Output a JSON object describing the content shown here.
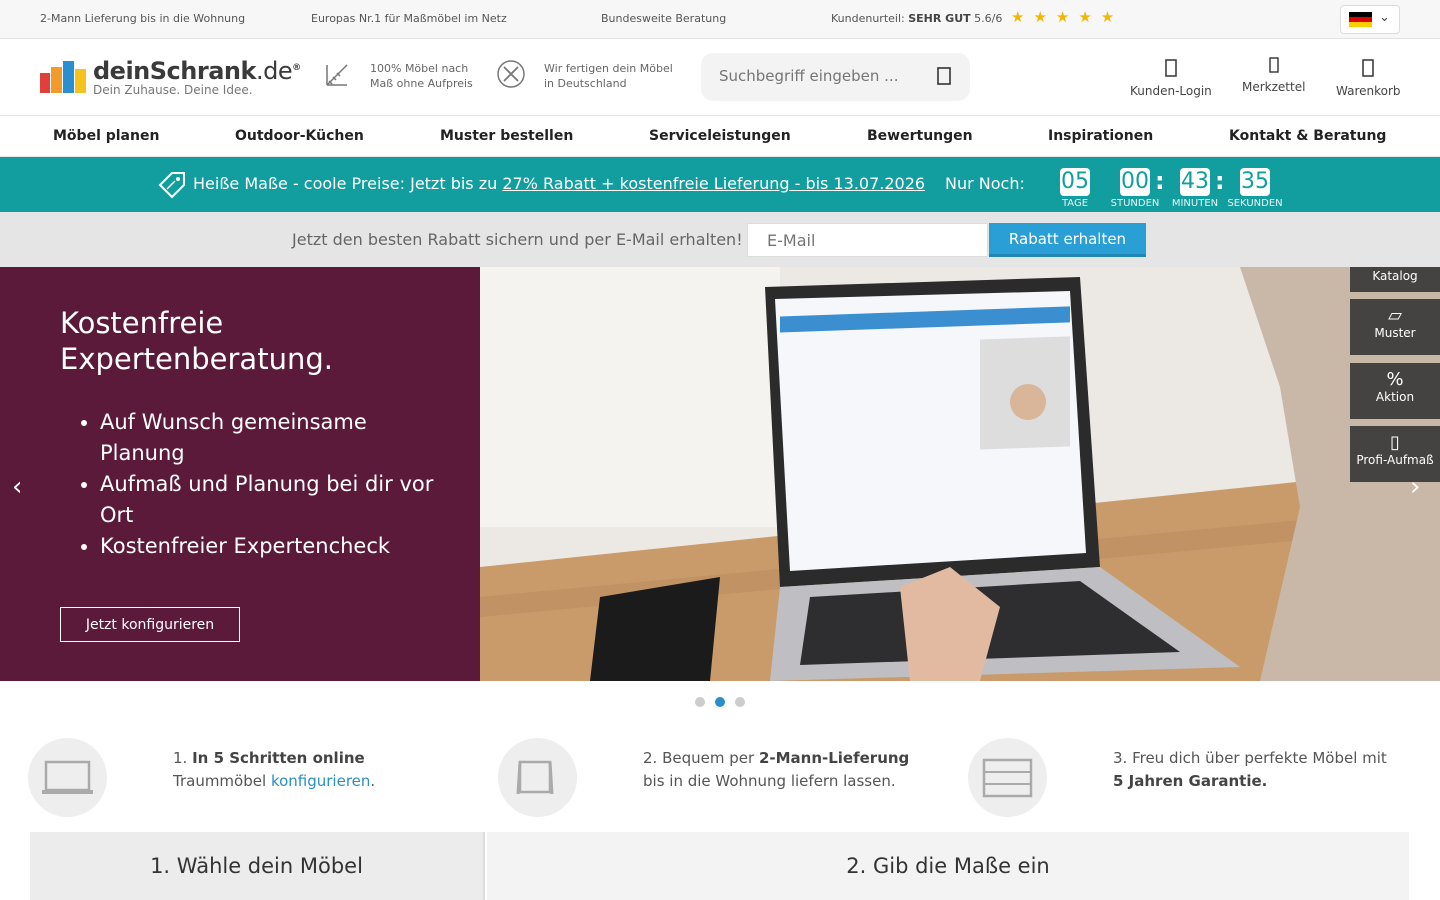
{
  "topbar": {
    "items": [
      "2-Mann Lieferung bis in die Wohnung",
      "Europas Nr.1 für Maßmöbel im Netz",
      "Bundesweite Beratung"
    ],
    "rating_label": "Kundenurteil:",
    "rating_value": "SEHR GUT",
    "rating_score": "5.6/6",
    "stars": "★★★★★",
    "language": "DE"
  },
  "header": {
    "logo_name": "deinSchrank",
    "logo_tld": ".de",
    "logo_reg": "®",
    "logo_tagline": "Dein Zuhause. Deine Idee.",
    "usp1_line1": "100% Möbel nach",
    "usp1_line2": "Maß ohne Aufpreis",
    "usp2_line1": "Wir fertigen dein Möbel",
    "usp2_line2": "in Deutschland",
    "search_placeholder": "Suchbegriff eingeben ...",
    "login": "Kunden-Login",
    "wishlist": "Merkzettel",
    "cart": "Warenkorb"
  },
  "nav": [
    "Möbel planen",
    "Outdoor-Küchen",
    "Muster bestellen",
    "Serviceleistungen",
    "Bewertungen",
    "Inspirationen",
    "Kontakt & Beratung"
  ],
  "promo": {
    "text": "Heiße Maße - coole Preise: Jetzt bis zu",
    "link": "27% Rabatt + kostenfreie Lieferung - bis 13.07.2026",
    "countdown_label": "Nur Noch:",
    "days": "05",
    "hours": "00",
    "minutes": "43",
    "seconds": "35",
    "days_label": "TAGE",
    "hours_label": "STUNDEN",
    "minutes_label": "MINUTEN",
    "seconds_label": "SEKUNDEN",
    "colon": ":"
  },
  "mail": {
    "label": "Jetzt den besten Rabatt sichern und per E-Mail erhalten!",
    "placeholder": "E-Mail",
    "button": "Rabatt erhalten"
  },
  "hero": {
    "title": "Kostenfreie Expertenberatung.",
    "bullets": [
      "Auf Wunsch gemeinsame Planung",
      "Aufmaß und Planung bei dir vor Ort",
      "Kostenfreier Expertencheck"
    ],
    "cta": "Jetzt konfigurieren",
    "active_slide": 2,
    "slide_count": 3
  },
  "sidebar": {
    "catalog": "Katalog",
    "samples": "Muster",
    "promo": "Aktion",
    "promo_icon_glyph": "%",
    "measure": "Profi-Aufmaß"
  },
  "steps": {
    "s1_prefix": "1.",
    "s1_bold": "In 5 Schritten online",
    "s1_text": "Traummöbel",
    "s1_link": "konfigurieren",
    "s1_end": ".",
    "s2_prefix": "2. Bequem per",
    "s2_bold": "2-Mann-Lieferung",
    "s2_text": "bis in die Wohnung liefern lassen.",
    "s3_text": "3. Freu dich über perfekte Möbel mit",
    "s3_bold": "5 Jahren Garantie."
  },
  "tabs": [
    "1. Wähle dein Möbel",
    "2. Gib die Maße ein"
  ],
  "colors": {
    "promo_bg": "#129e9e",
    "hero_left_bg": "#5c1a3a",
    "button_blue": "#2a9fd6",
    "star": "#f2b705"
  }
}
